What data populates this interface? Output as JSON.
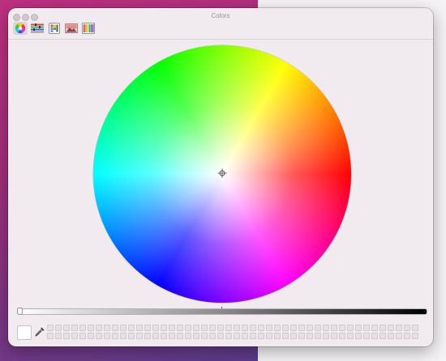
{
  "window": {
    "title": "Colors"
  },
  "toolbar": {
    "tools": [
      {
        "icon": "color-wheel-icon",
        "selected": true
      },
      {
        "icon": "color-sliders-icon",
        "selected": false
      },
      {
        "icon": "color-palettes-icon",
        "selected": false
      },
      {
        "icon": "image-palettes-icon",
        "selected": false
      },
      {
        "icon": "pencils-icon",
        "selected": false
      }
    ]
  },
  "picker": {
    "mode": "color-wheel",
    "brightness": 1.0,
    "current_color": "#ffffff"
  },
  "swatches": {
    "count": 92,
    "filled": 0
  }
}
